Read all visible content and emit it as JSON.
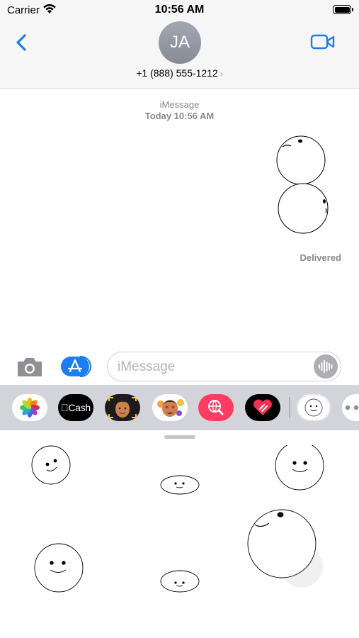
{
  "status_bar": {
    "carrier": "Carrier",
    "time": "10:56 AM"
  },
  "header": {
    "avatar_initials": "JA",
    "contact": "+1 (888) 555-1212",
    "contact_chevron": "›",
    "back_icon": "chevron-left-icon",
    "video_icon": "video-camera-icon"
  },
  "conversation": {
    "service": "iMessage",
    "timestamp": "Today 10:56 AM",
    "status": "Delivered"
  },
  "input": {
    "placeholder": "iMessage",
    "camera_icon": "camera-icon",
    "appstore_icon": "app-store-icon",
    "audio_icon": "waveform-icon"
  },
  "apps": {
    "cash_label": "Cash",
    "items": [
      "photos",
      "apple-cash",
      "memoji",
      "memoji-stickers",
      "web-search",
      "digital-touch",
      "smiley-stickers",
      "more"
    ]
  },
  "colors": {
    "accent": "#1a7df2",
    "gray_text": "#8a8a8e",
    "drawer": "#d3d4d9",
    "search_app": "#fe3c62"
  }
}
